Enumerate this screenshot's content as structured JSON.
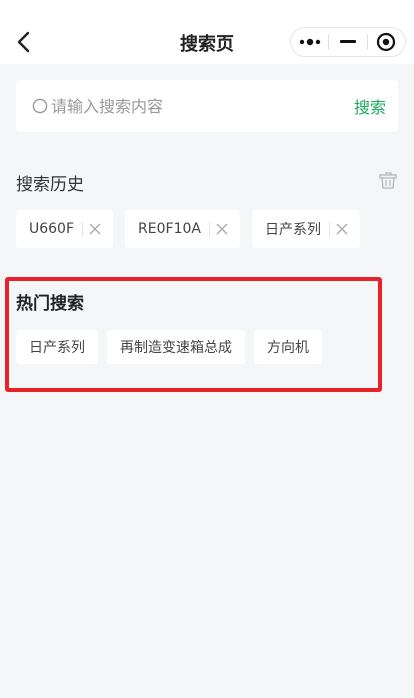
{
  "navbar": {
    "title": "搜索页"
  },
  "search": {
    "placeholder": "请输入搜索内容",
    "button_label": "搜索"
  },
  "history": {
    "title": "搜索历史",
    "items": [
      {
        "label": "U660F"
      },
      {
        "label": "RE0F10A"
      },
      {
        "label": "日产系列"
      }
    ]
  },
  "hot": {
    "title": "热门搜索",
    "items": [
      {
        "label": "日产系列"
      },
      {
        "label": "再制造变速箱总成"
      },
      {
        "label": "方向机"
      }
    ]
  },
  "colors": {
    "accent": "#1aad5d",
    "highlight_frame": "#e8202a",
    "background": "#f5f6f8"
  },
  "icons": [
    "back-arrow-icon",
    "more-dots-icon",
    "minimize-icon",
    "close-target-icon",
    "search-icon",
    "trash-icon",
    "close-icon"
  ]
}
